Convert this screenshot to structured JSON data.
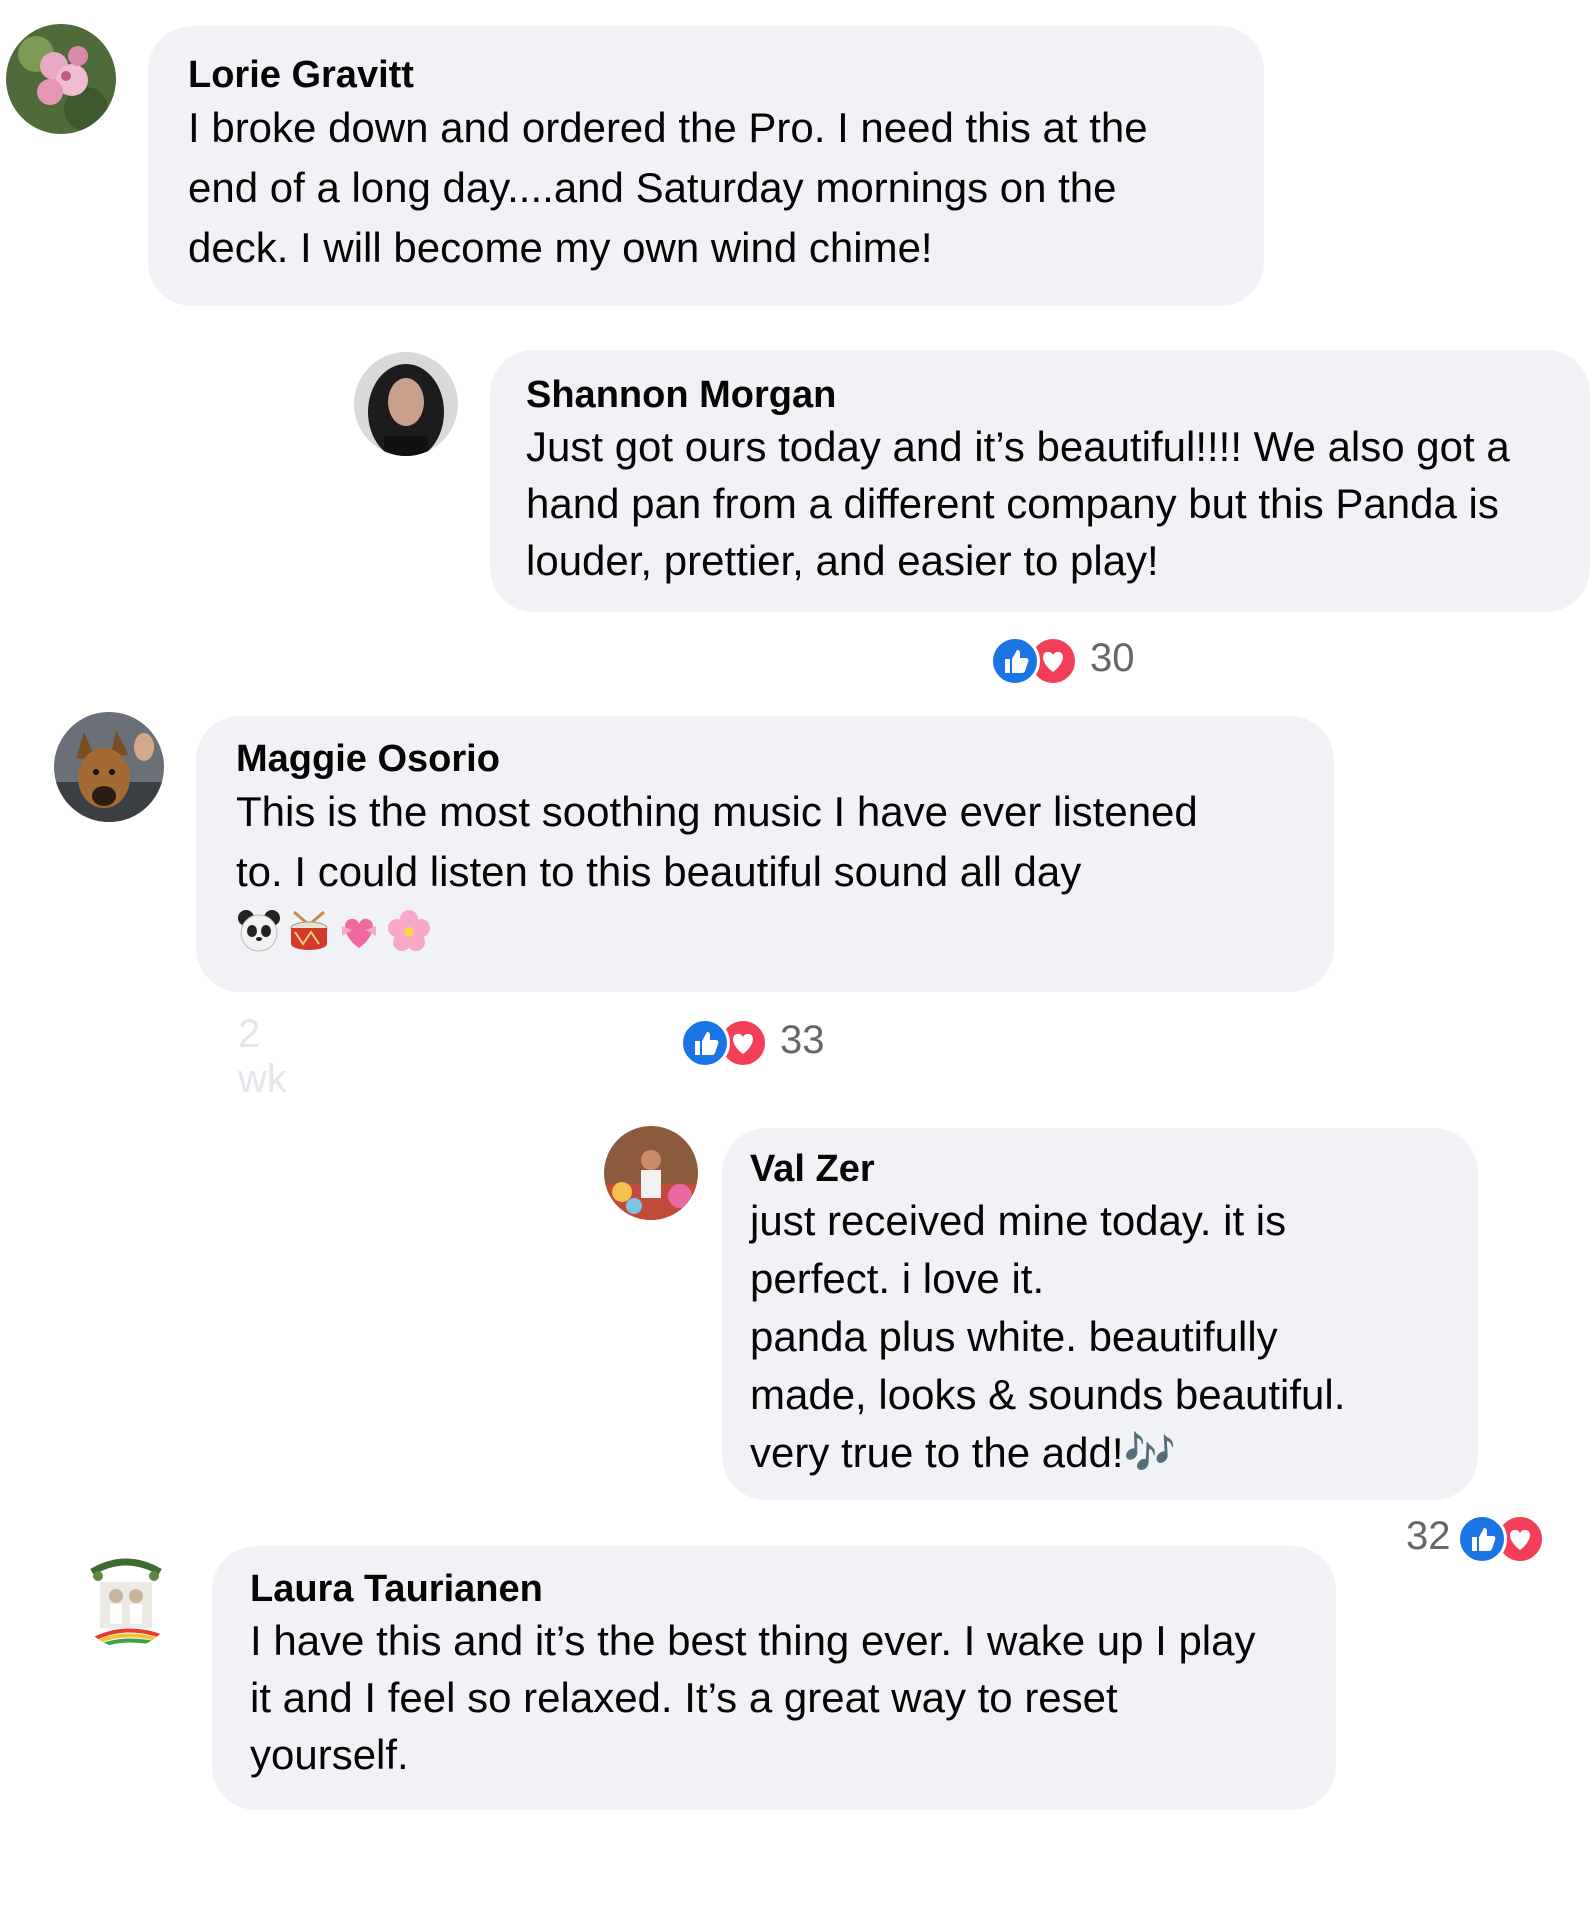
{
  "comments": [
    {
      "name": "Lorie Gravitt",
      "text": "I broke down and ordered the Pro. I need this at the\nend of a long day....and Saturday mornings on the\ndeck. I will become my own wind chime!"
    },
    {
      "name": "Shannon Morgan",
      "text": "Just got ours today and it’s beautiful!!!! We also got a\nhand pan from a different company but this Panda is\nlouder, prettier, and easier to play!",
      "reactions": "30"
    },
    {
      "name": "Maggie Osorio",
      "text": "This is the most soothing music I have ever listened\nto. I could listen to this beautiful sound all day",
      "emojis": [
        "panda-emoji",
        "drum-emoji",
        "heart-ribbon-emoji",
        "cherry-blossom-emoji"
      ],
      "reactions": "33",
      "timestamp": "2 wk"
    },
    {
      "name": "Val Zer",
      "text": "just received mine today. it is\nperfect. i love it.\npanda plus white. beautifully\nmade, looks & sounds beautiful.\nvery true to the add!🎶",
      "reactions": "32"
    },
    {
      "name": "Laura Taurianen",
      "text": "I have this and it’s the best thing ever. I wake up I play\nit and I feel so relaxed. It’s a great way to reset\nyourself."
    }
  ],
  "colors": {
    "bubble": "#f0f2f5",
    "like": "#1b74e4",
    "love": "#f33e58",
    "meta_text": "#65676b"
  },
  "icons": {
    "like": "thumbs-up-icon",
    "love": "heart-icon"
  }
}
